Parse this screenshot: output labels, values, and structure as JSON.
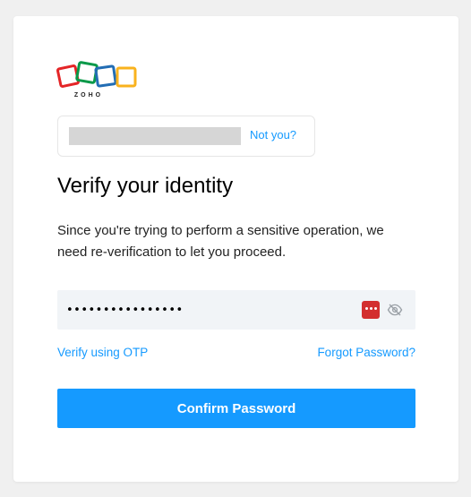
{
  "brand": {
    "name": "ZOHO"
  },
  "user": {
    "not_you_label": "Not you?"
  },
  "heading": "Verify your identity",
  "description": "Since you're trying to perform a sensitive operation, we need re-verification to let you proceed.",
  "password": {
    "value": "••••••••••••••••"
  },
  "links": {
    "otp": "Verify using OTP",
    "forgot": "Forgot Password?"
  },
  "confirm_button": "Confirm Password",
  "colors": {
    "accent": "#159aff",
    "pm_red": "#d32f2f",
    "field_bg": "#f1f4f7"
  },
  "icons": {
    "password_manager": "password-manager-icon",
    "visibility": "eye-slash-icon"
  }
}
